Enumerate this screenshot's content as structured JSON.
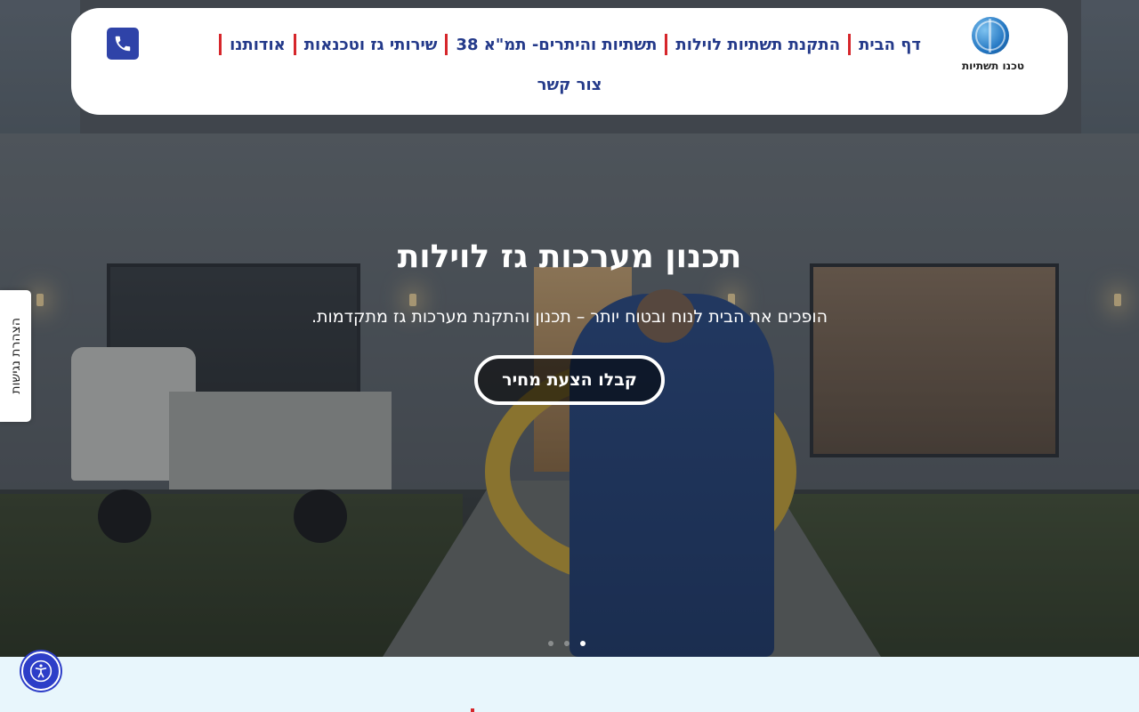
{
  "header": {
    "logo_text": "טכנו תשתיות",
    "nav": [
      {
        "label": "דף הבית"
      },
      {
        "label": "התקנת תשתיות לוילות"
      },
      {
        "label": "תשתיות והיתרים- תמ\"א 38"
      },
      {
        "label": "שירותי גז וטכנאות"
      },
      {
        "label": "אודותנו"
      }
    ],
    "nav_row2": "צור קשר",
    "phone_icon": "phone-icon"
  },
  "hero": {
    "title": "תכנון מערכות גז לוילות",
    "subtitle": "הופכים את הבית לנוח ובטוח יותר – תכנון והתקנת מערכות גז מתקדמות.",
    "cta_label": "קבלו הצעת מחיר",
    "slides_total": 3,
    "active_slide": 3
  },
  "side_tab": {
    "label": "הצהרת נגישות"
  },
  "accessibility_button": {
    "icon": "accessibility-icon"
  },
  "colors": {
    "nav_text": "#243a8a",
    "nav_separator": "#d6262b",
    "phone_button": "#2f43a8",
    "accessibility_button": "#2d3ec8",
    "section_bg": "#e8f6fc"
  }
}
